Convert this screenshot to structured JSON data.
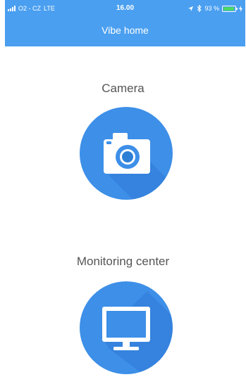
{
  "status_bar": {
    "carrier": "O2 - CZ",
    "network": "LTE",
    "time": "16.00",
    "battery_percent": "93 %",
    "battery_level": 0.93,
    "battery_color": "#4cd964"
  },
  "header": {
    "title": "Vibe home",
    "background": "#4a9ff0"
  },
  "actions": [
    {
      "label": "Camera",
      "icon": "camera-icon",
      "color": "#3d8fe8"
    },
    {
      "label": "Monitoring center",
      "icon": "monitor-icon",
      "color": "#3d8fe8"
    }
  ]
}
